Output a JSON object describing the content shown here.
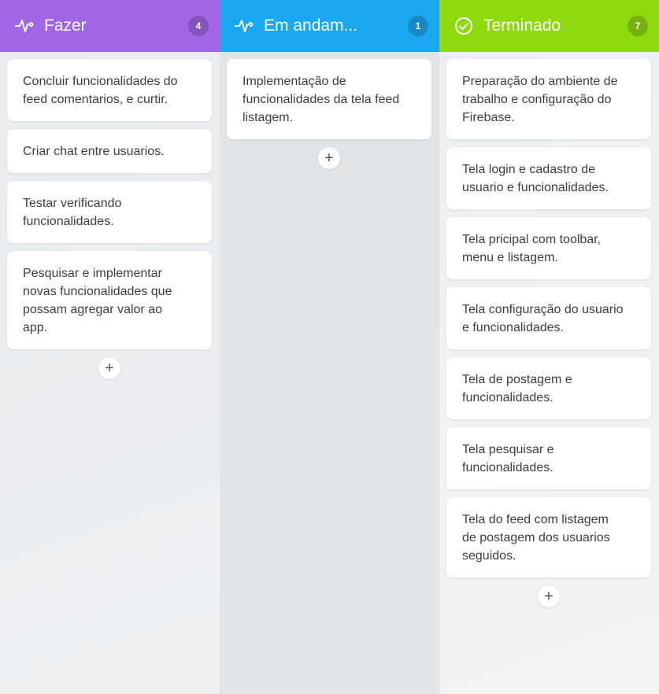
{
  "colors": {
    "fazer": "#a066e6",
    "em_andamento": "#1aa9f0",
    "terminado": "#8ed80e"
  },
  "columns": [
    {
      "title": "Fazer",
      "count": "4",
      "icon": "activity-icon",
      "cards": [
        "Concluir funcionalidades do feed comentarios, e curtir.",
        "Criar chat entre usuarios.",
        "Testar verificando funcionalidades.",
        "Pesquisar e implementar novas funcionalidades que possam agregar valor ao app."
      ],
      "add_label": "+"
    },
    {
      "title": "Em andam...",
      "count": "1",
      "icon": "activity-icon",
      "cards": [
        "Implementação de funcionalidades da tela feed listagem."
      ],
      "add_label": "+"
    },
    {
      "title": "Terminado",
      "count": "7",
      "icon": "check-circle-icon",
      "cards": [
        "Preparação do ambiente de trabalho e configuração do Firebase.",
        "Tela login e cadastro de usuario e funcionalidades.",
        "Tela pricipal com toolbar, menu e listagem.",
        "Tela configuração do usuario e funcionalidades.",
        "Tela de postagem e funcionalidades.",
        "Tela pesquisar e funcionalidades.",
        "Tela do feed com listagem de postagem dos usuarios seguidos."
      ],
      "add_label": "+"
    }
  ]
}
